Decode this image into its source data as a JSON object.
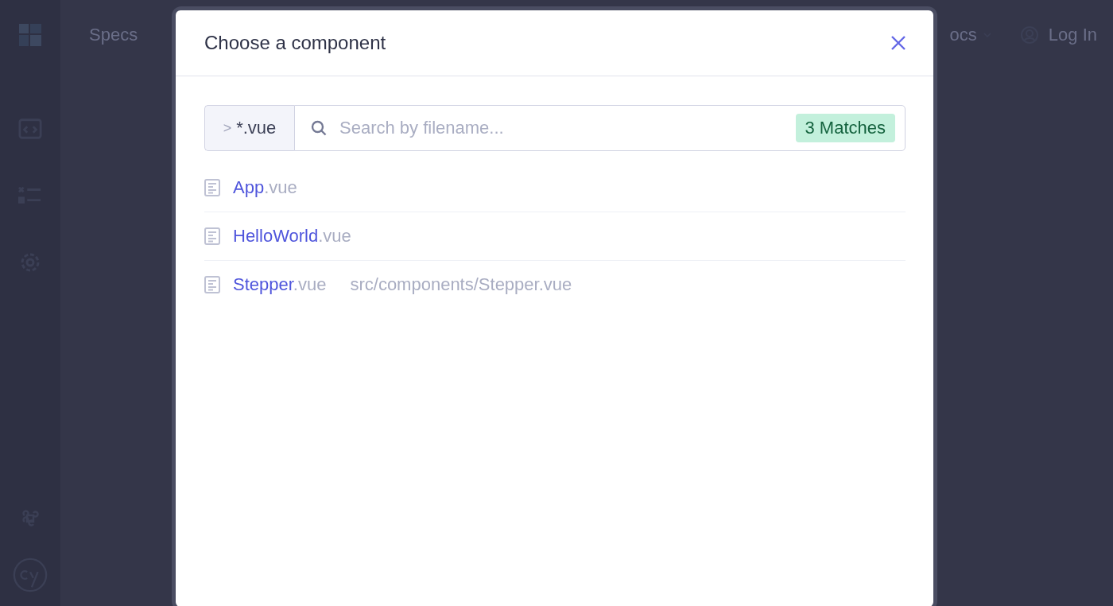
{
  "app": {
    "nav_title": "Specs",
    "docs_link": "ocs",
    "login": "Log In"
  },
  "modal": {
    "title": "Choose a component",
    "filter": {
      "chevron": ">",
      "value": "*.vue"
    },
    "search": {
      "placeholder": "Search by filename..."
    },
    "match_count": "3 Matches",
    "files": [
      {
        "name": "App",
        "extension": ".vue"
      },
      {
        "name": "HelloWorld",
        "extension": ".vue"
      },
      {
        "name": "Stepper",
        "extension": ".vue",
        "path": "src/components/Stepper.vue"
      }
    ]
  }
}
